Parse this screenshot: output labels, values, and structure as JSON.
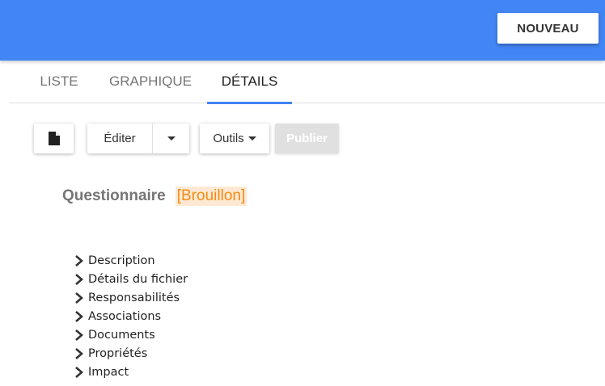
{
  "header": {
    "new_label": "NOUVEAU",
    "bar_color": "#4285f4"
  },
  "tabs": [
    {
      "label": "LISTE",
      "active": false
    },
    {
      "label": "GRAPHIQUE",
      "active": false
    },
    {
      "label": "DÉTAILS",
      "active": true
    }
  ],
  "toolbar": {
    "file_icon": "file-icon",
    "edit_label": "Éditer",
    "tools_label": "Outils",
    "publish_label": "Publier"
  },
  "document": {
    "title": "Questionnaire",
    "status": "[Brouillon]",
    "status_color": "#f28b15"
  },
  "sections": [
    {
      "label": "Description"
    },
    {
      "label": "Détails du fichier"
    },
    {
      "label": "Responsabilités"
    },
    {
      "label": "Associations"
    },
    {
      "label": "Documents"
    },
    {
      "label": "Propriétés"
    },
    {
      "label": "Impact"
    }
  ]
}
